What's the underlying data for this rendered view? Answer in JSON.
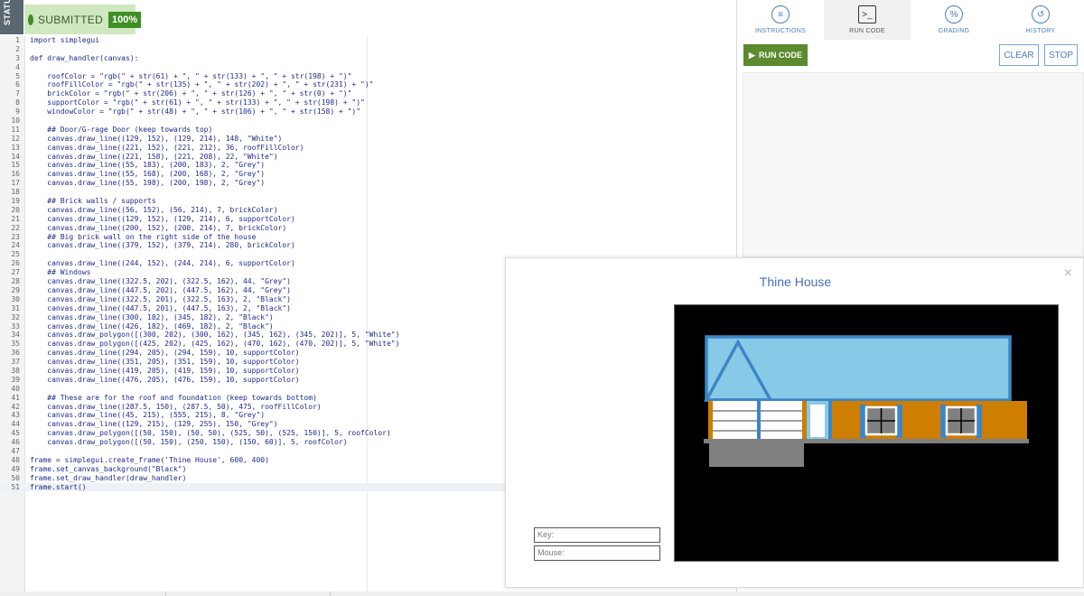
{
  "status_strip": {
    "label": "STATUS"
  },
  "badge": {
    "label": "SUBMITTED",
    "percent": "100%"
  },
  "tabs": [
    {
      "label": "INSTRUCTIONS",
      "icon": "instructions-icon"
    },
    {
      "label": "RUN CODE",
      "icon": "terminal-icon"
    },
    {
      "label": "GRADING",
      "icon": "grading-icon"
    },
    {
      "label": "HISTORY",
      "icon": "history-icon"
    }
  ],
  "toolbar": {
    "run_label": "RUN CODE",
    "clear_label": "CLEAR",
    "stop_label": "STOP"
  },
  "frame": {
    "title": "Thine House",
    "key_label": "Key:",
    "mouse_label": "Mouse:",
    "close_glyph": "×"
  },
  "code_lines": [
    "import simplegui",
    "",
    "def draw_handler(canvas):",
    "",
    "    roofColor = \"rgb(\" + str(61) + \", \" + str(133) + \", \" + str(198) + \")\"",
    "    roofFillColor = \"rgb(\" + str(135) + \", \" + str(202) + \", \" + str(231) + \")\"",
    "    brickColor = \"rgb(\" + str(206) + \", \" + str(126) + \", \" + str(0) + \")\"",
    "    supportColor = \"rgb(\" + str(61) + \", \" + str(133) + \", \" + str(198) + \")\"",
    "    windowColor = \"rgb(\" + str(48) + \", \" + str(106) + \", \" + str(158) + \")\"",
    "",
    "    ## Door/G-rage Door (keep towards top)",
    "    canvas.draw_line((129, 152), (129, 214), 148, \"White\")",
    "    canvas.draw_line((221, 152), (221, 212), 36, roofFillColor)",
    "    canvas.draw_line((221, 158), (221, 208), 22, \"White\")",
    "    canvas.draw_line((55, 183), (200, 183), 2, \"Grey\")",
    "    canvas.draw_line((55, 168), (200, 168), 2, \"Grey\")",
    "    canvas.draw_line((55, 198), (200, 198), 2, \"Grey\")",
    "",
    "    ## Brick walls / supports",
    "    canvas.draw_line((56, 152), (56, 214), 7, brickColor)",
    "    canvas.draw_line((129, 152), (129, 214), 6, supportColor)",
    "    canvas.draw_line((200, 152), (200, 214), 7, brickColor)",
    "    ## Big brick wall on the right side of the house",
    "    canvas.draw_line((379, 152), (379, 214), 280, brickColor)",
    "",
    "    canvas.draw_line((244, 152), (244, 214), 6, supportColor)",
    "    ## Windows",
    "    canvas.draw_line((322.5, 202), (322.5, 162), 44, \"Grey\")",
    "    canvas.draw_line((447.5, 202), (447.5, 162), 44, \"Grey\")",
    "    canvas.draw_line((322.5, 201), (322.5, 163), 2, \"Black\")",
    "    canvas.draw_line((447.5, 201), (447.5, 163), 2, \"Black\")",
    "    canvas.draw_line((300, 182), (345, 182), 2, \"Black\")",
    "    canvas.draw_line((426, 182), (469, 182), 2, \"Black\")",
    "    canvas.draw_polygon([(300, 202), (300, 162), (345, 162), (345, 202)], 5, \"White\")",
    "    canvas.draw_polygon([(425, 202), (425, 162), (470, 162), (470, 202)], 5, \"White\")",
    "    canvas.draw_line((294, 205), (294, 159), 10, supportColor)",
    "    canvas.draw_line((351, 205), (351, 159), 10, supportColor)",
    "    canvas.draw_line((419, 205), (419, 159), 10, supportColor)",
    "    canvas.draw_line((476, 205), (476, 159), 10, supportColor)",
    "",
    "    ## These are for the roof and foundation (keep towards bottom)",
    "    canvas.draw_line((287.5, 150), (287.5, 50), 475, roofFillColor)",
    "    canvas.draw_line((45, 215), (555, 215), 8, \"Grey\")",
    "    canvas.draw_line((129, 215), (129, 255), 150, \"Grey\")",
    "    canvas.draw_polygon([(50, 150), (50, 50), (525, 50), (525, 150)], 5, roofColor)",
    "    canvas.draw_polygon([(50, 150), (250, 150), (150, 60)], 5, roofColor)",
    "",
    "frame = simplegui.create_frame('Thine House', 600, 400)",
    "frame.set_canvas_background(\"Black\")",
    "frame.set_draw_handler(draw_handler)",
    "frame.start()"
  ],
  "colors": {
    "roof": "#3d85c6",
    "roof_fill": "#87cae7",
    "brick": "#ce7e00",
    "support": "#3d85c6",
    "grey": "#808080",
    "white": "#ffffff",
    "black": "#000000",
    "accent_green": "#5b8b2e"
  }
}
